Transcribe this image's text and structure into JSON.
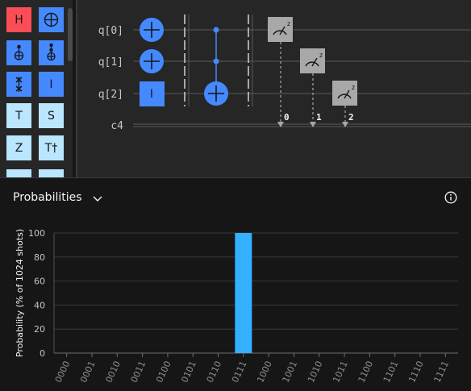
{
  "palette": {
    "gates": [
      {
        "label": "H",
        "kind": "text",
        "bg": "#fa4d56",
        "fg": "#161616"
      },
      {
        "label": "",
        "kind": "oplus",
        "bg": "#4589ff",
        "fg": "#161616"
      },
      {
        "label": "",
        "kind": "cnot",
        "bg": "#4589ff",
        "fg": "#161616"
      },
      {
        "label": "",
        "kind": "toffoli",
        "bg": "#4589ff",
        "fg": "#161616"
      },
      {
        "label": "",
        "kind": "swap",
        "bg": "#4589ff",
        "fg": "#161616"
      },
      {
        "label": "I",
        "kind": "text",
        "bg": "#4589ff",
        "fg": "#161616"
      },
      {
        "label": "T",
        "kind": "text",
        "bg": "#bae6ff",
        "fg": "#161616"
      },
      {
        "label": "S",
        "kind": "text",
        "bg": "#bae6ff",
        "fg": "#161616"
      },
      {
        "label": "Z",
        "kind": "text",
        "bg": "#bae6ff",
        "fg": "#161616"
      },
      {
        "label": "T†",
        "kind": "text",
        "bg": "#bae6ff",
        "fg": "#161616"
      }
    ]
  },
  "circuit": {
    "qubits": [
      "q[0]",
      "q[1]",
      "q[2]"
    ],
    "classical": "c4",
    "identity_label": "I",
    "measure_label": "z",
    "measure_bits": [
      "0",
      "1",
      "2"
    ]
  },
  "panel": {
    "title": "Probabilities"
  },
  "chart_data": {
    "type": "bar",
    "categories": [
      "0000",
      "0001",
      "0010",
      "0011",
      "0100",
      "0101",
      "0110",
      "0111",
      "1000",
      "1001",
      "1010",
      "1011",
      "1100",
      "1101",
      "1110",
      "1111"
    ],
    "values": [
      0,
      0,
      0,
      0,
      0,
      0,
      0,
      100,
      0,
      0,
      0,
      0,
      0,
      0,
      0,
      0
    ],
    "ylabel": "Probability (% of 1024 shots)",
    "ylim": [
      0,
      100
    ],
    "yticks": [
      0,
      20,
      40,
      60,
      80,
      100
    ],
    "grid": true,
    "bar_color": "#33b1ff"
  }
}
